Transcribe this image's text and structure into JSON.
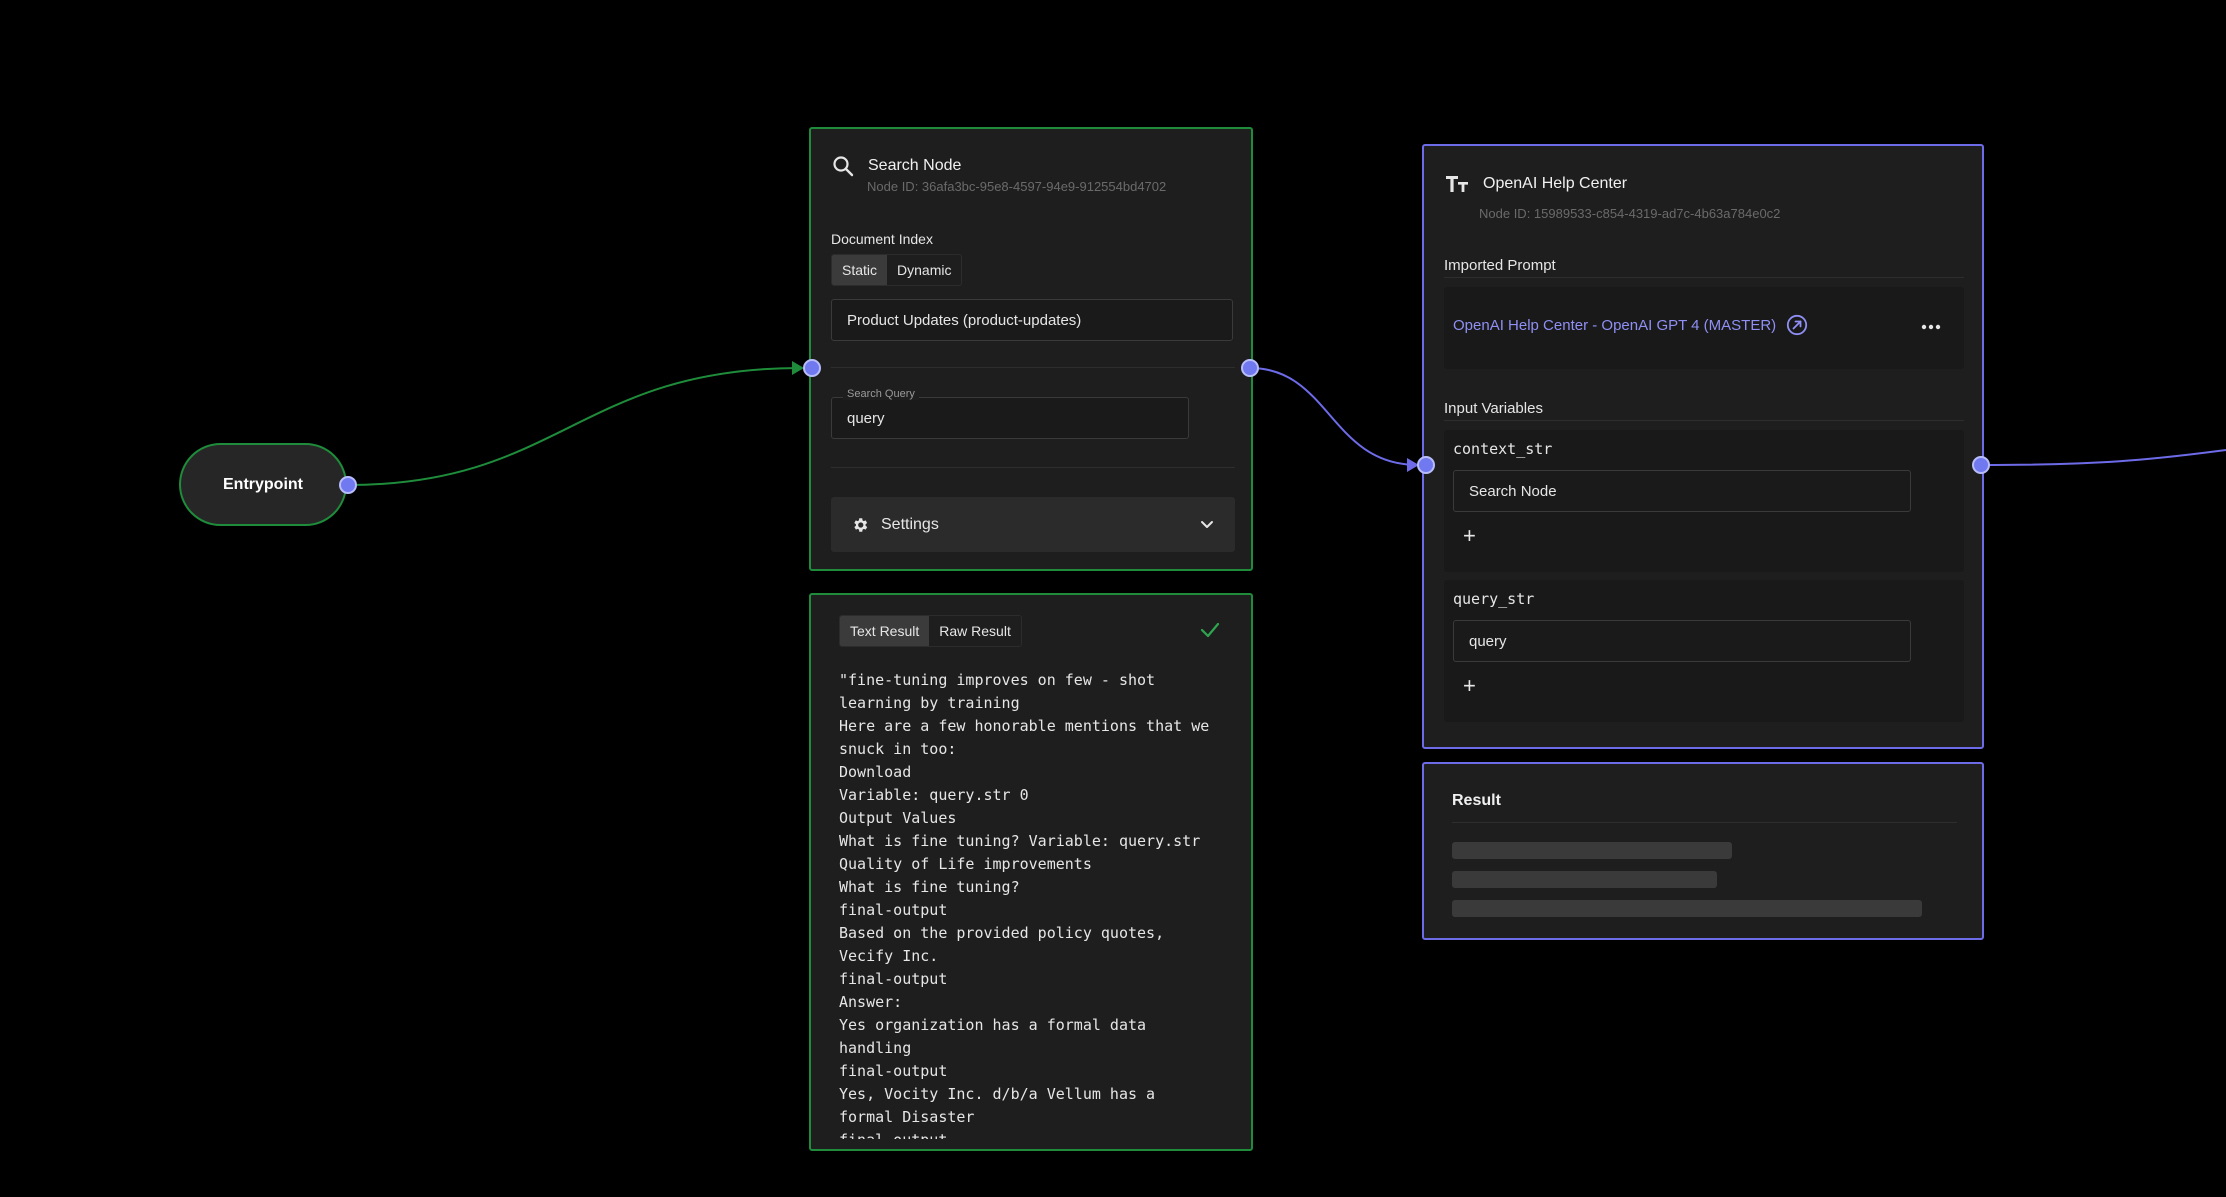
{
  "entrypoint": {
    "label": "Entrypoint"
  },
  "search_node": {
    "title": "Search Node",
    "icon": "search-icon",
    "node_id": "Node ID: 36afa3bc-95e8-4597-94e9-912554bd4702",
    "document_index_label": "Document Index",
    "index_tabs": [
      "Static",
      "Dynamic"
    ],
    "index_value": "Product Updates (product-updates)",
    "search_query_label": "Search Query",
    "search_query_value": "query",
    "settings_label": "Settings"
  },
  "search_result": {
    "tabs": [
      "Text Result",
      "Raw Result"
    ],
    "status_icon": "check-icon",
    "text": "\"fine-tuning improves on few - shot\nlearning by training\nHere are a few honorable mentions that we\nsnuck in too:\nDownload\nVariable: query.str 0\nOutput Values\nWhat is fine tuning? Variable: query.str\nQuality of Life improvements\nWhat is fine tuning?\nfinal-output\nBased on the provided policy quotes,\nVecify Inc.\nfinal-output\nAnswer:\nYes organization has a formal data\nhandling\nfinal-output\nYes, Vocity Inc. d/b/a Vellum has a\nformal Disaster\nfinal-output"
  },
  "prompt_node": {
    "title": "OpenAI Help Center",
    "icon": "text-type-icon",
    "node_id": "Node ID: 15989533-c854-4319-ad7c-4b63a784e0c2",
    "imported_prompt_label": "Imported Prompt",
    "prompt_link": "OpenAI Help Center - OpenAI GPT 4 (MASTER)",
    "input_variables_label": "Input Variables",
    "variables": [
      {
        "name": "context_str",
        "value": "Search Node"
      },
      {
        "name": "query_str",
        "value": "query"
      }
    ]
  },
  "prompt_result": {
    "title": "Result"
  },
  "colors": {
    "green_border": "#1e8c3a",
    "blue_border": "#6e6be8",
    "handle": "#7079f0",
    "link": "#8f8ff5"
  }
}
